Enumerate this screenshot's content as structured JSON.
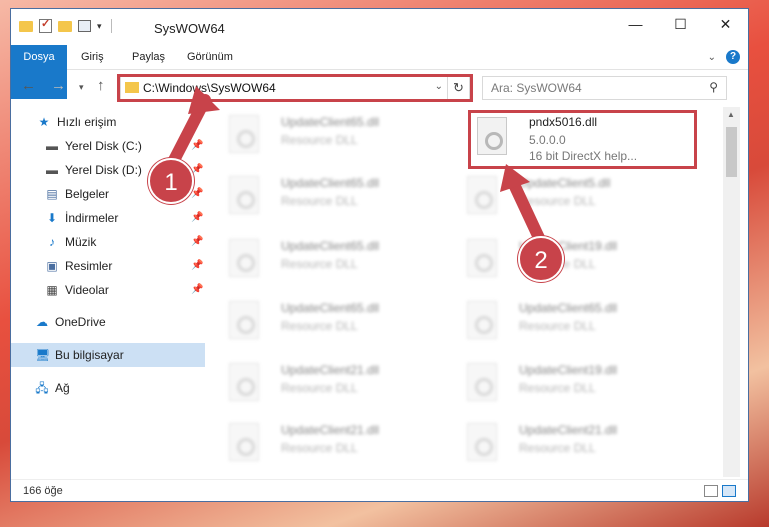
{
  "window": {
    "title": "SysWOW64",
    "controls": {
      "minimize": "—",
      "maximize": "☐",
      "close": "✕"
    }
  },
  "ribbon": {
    "tabs": [
      "Dosya",
      "Giriş",
      "Paylaş",
      "Görünüm"
    ]
  },
  "address": {
    "path": "C:\\Windows\\SysWOW64",
    "search_placeholder": "Ara: SysWOW64"
  },
  "sidebar": {
    "quick_access": "Hızlı erişim",
    "items": [
      {
        "label": "Yerel Disk (C:)",
        "icon": "drive-icon"
      },
      {
        "label": "Yerel Disk (D:)",
        "icon": "drive-icon"
      },
      {
        "label": "Belgeler",
        "icon": "documents-icon"
      },
      {
        "label": "İndirmeler",
        "icon": "downloads-icon"
      },
      {
        "label": "Müzik",
        "icon": "music-icon"
      },
      {
        "label": "Resimler",
        "icon": "pictures-icon"
      },
      {
        "label": "Videolar",
        "icon": "videos-icon"
      }
    ],
    "onedrive": "OneDrive",
    "this_pc": "Bu bilgisayar",
    "network": "Ağ"
  },
  "files": {
    "highlighted": {
      "name": "pndx5016.dll",
      "version": "5.0.0.0",
      "description": "16 bit DirectX help..."
    },
    "left_column": [
      {
        "name": "UpdateClient65.dll",
        "type": "Resource DLL"
      },
      {
        "name": "UpdateClient65.dll",
        "type": "Resource DLL"
      },
      {
        "name": "UpdateClient65.dll",
        "type": "Resource DLL"
      },
      {
        "name": "UpdateClient65.dll",
        "type": "Resource DLL"
      },
      {
        "name": "UpdateClient21.dll",
        "type": "Resource DLL"
      },
      {
        "name": "UpdateClient21.dll",
        "type": "Resource DLL"
      }
    ],
    "right_column": [
      {
        "name": "UpdateClient5.dll",
        "type": "Resource DLL"
      },
      {
        "name": "UpdateClient19.dll",
        "type": "Resource DLL"
      },
      {
        "name": "UpdateClient65.dll",
        "type": "Resource DLL"
      },
      {
        "name": "UpdateClient19.dll",
        "type": "Resource DLL"
      },
      {
        "name": "UpdateClient21.dll",
        "type": "Resource DLL"
      }
    ]
  },
  "status": {
    "count": "166 öğe"
  },
  "annotations": {
    "step1": "1",
    "step2": "2"
  },
  "colors": {
    "accent": "#1979ca",
    "highlight": "#c8434a",
    "folder": "#f4c64b"
  }
}
